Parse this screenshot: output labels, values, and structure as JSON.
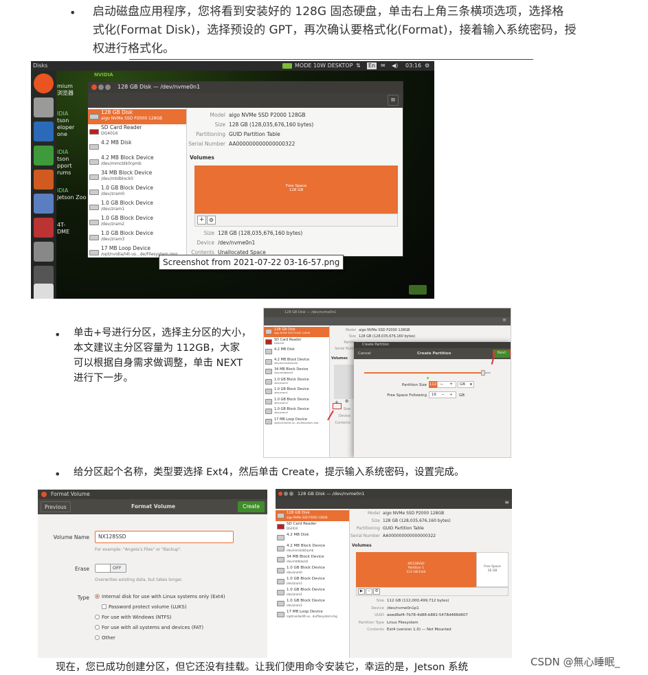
{
  "step1": {
    "bullet": "•",
    "lines": [
      "启动磁盘应用程序，您将看到安装好的 128G 固态硬盘，单击右上角三条横项选项，选择格",
      "式化(Format Disk)，选择预设的 GPT，再次确认要格式化(Format)，接着输入系统密码，授",
      "权进行格式化。"
    ]
  },
  "shot1": {
    "topbar_left": "Disks",
    "topbar_right": "MODE 10W DESKTOP",
    "topbar_lang": "En",
    "topbar_time": "03:16",
    "bg_labels": [
      "mium",
      "浏览器",
      "IDIA",
      "tson",
      "eloper",
      "one",
      "IDIA",
      "tson",
      "pport",
      "rums",
      "IDIA",
      "Jetson Zoo",
      "4T-",
      "DME"
    ],
    "window_title": "128 GB Disk — /dev/nvme0n1",
    "sidebar": [
      {
        "name": "128 GB Disk",
        "sub": "aigo NVMe SSD P2000 128GB"
      },
      {
        "name": "SD Card Reader",
        "sub": "DG4016"
      },
      {
        "name": "4.2 MB Disk",
        "sub": ""
      },
      {
        "name": "4.2 MB Block Device",
        "sub": "/dev/mmcblk0rpmb"
      },
      {
        "name": "34 MB Block Device",
        "sub": "/dev/mtdblock0"
      },
      {
        "name": "1.0 GB Block Device",
        "sub": "/dev/zram0"
      },
      {
        "name": "1.0 GB Block Device",
        "sub": "/dev/zram1"
      },
      {
        "name": "1.0 GB Block Device",
        "sub": "/dev/zram2"
      },
      {
        "name": "1.0 GB Block Device",
        "sub": "/dev/zram3"
      },
      {
        "name": "17 MB Loop Device",
        "sub": "/opt/nvidia/l4t-us...de/Filesystem.img"
      }
    ],
    "info": [
      {
        "k": "Model",
        "v": "aigo NVMe SSD P2000 128GB"
      },
      {
        "k": "Size",
        "v": "128 GB (128,035,676,160 bytes)"
      },
      {
        "k": "Partitioning",
        "v": "GUID Partition Table"
      },
      {
        "k": "Serial Number",
        "v": "AA000000000000000322"
      }
    ],
    "volumes_label": "Volumes",
    "free_space": "Free Space",
    "free_size": "128 GB",
    "plus": "+",
    "gear": "⚙",
    "detail": [
      {
        "k": "Size",
        "v": "128 GB (128,035,676,160 bytes)"
      },
      {
        "k": "Device",
        "v": "/dev/nvme0n1"
      },
      {
        "k": "Contents",
        "v": "Unallocated Space"
      }
    ],
    "tooltip": "Screenshot from 2021-07-22 03-16-57.png",
    "nvidia": "NVIDIA"
  },
  "step2": {
    "bullet": "•",
    "lines": [
      "单击+号进行分区，选择主分区的大小，",
      "本文建议主分区容量为 112GB，大家",
      "可以根据自身需求做调整，单击 NEXT",
      "进行下一步。"
    ]
  },
  "shot2": {
    "window_title": "128 GB Disk — /dev/nvme0n1",
    "sidebar": [
      {
        "name": "128 GB Disk",
        "sub": "aigo NVMe SSD P2000 128GB"
      },
      {
        "name": "SD Card Reader",
        "sub": "DG4016"
      },
      {
        "name": "4.2 MB Disk",
        "sub": ""
      },
      {
        "name": "4.2 MB Block Device",
        "sub": "/dev/mmcblk0rpmb"
      },
      {
        "name": "34 MB Block Device",
        "sub": "/dev/mtdblock0"
      },
      {
        "name": "1.0 GB Block Device",
        "sub": "/dev/zram0"
      },
      {
        "name": "1.0 GB Block Device",
        "sub": "/dev/zram1"
      },
      {
        "name": "1.0 GB Block Device",
        "sub": "/dev/zram2"
      },
      {
        "name": "1.0 GB Block Device",
        "sub": "/dev/zram3"
      },
      {
        "name": "17 MB Loop Device",
        "sub": "/opt/nvidia/l4t-us...du/filesystem.img"
      }
    ],
    "info": [
      {
        "k": "Model",
        "v": "aigo NVMe SSD P2000 128GB"
      },
      {
        "k": "Size",
        "v": "128 GB (128,035,676,160 bytes)"
      },
      {
        "k": "Partitio",
        "v": ""
      },
      {
        "k": "Serial Numb",
        "v": ""
      }
    ],
    "volumes_label": "Volumes",
    "detail_keys": [
      "Size",
      "Device",
      "Contents"
    ],
    "dialog_title": "Create Partition",
    "cancel": "Cancel",
    "header": "Create Partition",
    "next": "Next",
    "partition_size_label": "Partition Size",
    "partition_size_value": "112",
    "free_following_label": "Free Space Following",
    "free_following_value": "16",
    "unit": "GB",
    "minus": "−",
    "plus": "+"
  },
  "step3": {
    "bullet": "•",
    "text": "给分区起个名称，类型要选择 Ext4，然后单击 Create，提示输入系统密码，设置完成。"
  },
  "shot3": {
    "title": "Format Volume",
    "previous": "Previous",
    "header": "Format Volume",
    "create": "Create",
    "name_label": "Volume Name",
    "name_value": "NX128SSD",
    "name_hint": "For example: \"Angela's Files\" or \"Backup\".",
    "erase_label": "Erase",
    "erase_value": "OFF",
    "erase_hint": "Overwrites existing data, but takes longer.",
    "type_label": "Type",
    "options": [
      "Internal disk for use with Linux systems only (Ext4)",
      "Password protect volume (LUKS)",
      "For use with Windows (NTFS)",
      "For use with all systems and devices (FAT)",
      "Other"
    ]
  },
  "shot4": {
    "window_title": "128 GB Disk — /dev/nvme0n1",
    "sidebar": [
      {
        "name": "128 GB Disk",
        "sub": "aigo NVMe SSD P2000 128GB"
      },
      {
        "name": "SD Card Reader",
        "sub": "DG4016"
      },
      {
        "name": "4.2 MB Disk",
        "sub": ""
      },
      {
        "name": "4.2 MB Block Device",
        "sub": "/dev/mmcblk0rpmb"
      },
      {
        "name": "34 MB Block Device",
        "sub": "/dev/mtdblock0"
      },
      {
        "name": "1.0 GB Block Device",
        "sub": "/dev/zram0"
      },
      {
        "name": "1.0 GB Block Device",
        "sub": "/dev/zram1"
      },
      {
        "name": "1.0 GB Block Device",
        "sub": "/dev/zram2"
      },
      {
        "name": "1.0 GB Block Device",
        "sub": "/dev/zram3"
      },
      {
        "name": "17 MB Loop Device",
        "sub": "/opt/nvidia/l4t-us...du/filesystem.img"
      }
    ],
    "info": [
      {
        "k": "Model",
        "v": "aigo NVMe SSD P2000 128GB"
      },
      {
        "k": "Size",
        "v": "128 GB (128,035,676,160 bytes)"
      },
      {
        "k": "Partitioning",
        "v": "GUID Partition Table"
      },
      {
        "k": "Serial Number",
        "v": "AA000000000000000322"
      }
    ],
    "volumes_label": "Volumes",
    "part_lines": [
      "NX128SSD",
      "Partition 1",
      "112 GB Ext4"
    ],
    "free_lines": [
      "Free Space",
      "16 GB"
    ],
    "detail": [
      {
        "k": "Size",
        "v": "112 GB (112,000,499,712 bytes)"
      },
      {
        "k": "Device",
        "v": "/dev/nvme0n1p1"
      },
      {
        "k": "UUID",
        "v": "aeed8af4-7b78-4d88-b882-5478d488d607"
      },
      {
        "k": "Partition Type",
        "v": "Linux Filesystem"
      },
      {
        "k": "Contents",
        "v": "Ext4 (version 1.0) — Not Mounted"
      }
    ],
    "play": "▶",
    "minus": "−",
    "gear": "⚙"
  },
  "footer": {
    "text": "现在，您已成功创建分区，但它还没有挂载。让我们使用命令安装它，幸运的是，Jetson 系统",
    "watermark": "CSDN @無心睡眠_"
  }
}
